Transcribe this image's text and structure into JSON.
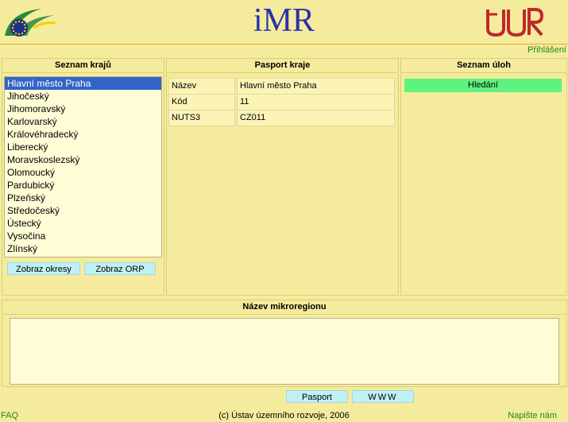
{
  "header": {
    "title": "iMR",
    "logo_left": "eu-flag-swoosh-logo",
    "logo_right": "uur-logo",
    "login_link": "Přihlášení"
  },
  "regions_panel": {
    "heading": "Seznam krajů",
    "items": [
      {
        "label": "Hlavní město Praha",
        "selected": true
      },
      {
        "label": "Jihočeský"
      },
      {
        "label": "Jihomoravský"
      },
      {
        "label": "Karlovarský"
      },
      {
        "label": "Královéhradecký"
      },
      {
        "label": "Liberecký"
      },
      {
        "label": "Moravskoslezský"
      },
      {
        "label": "Olomoucký"
      },
      {
        "label": "Pardubický"
      },
      {
        "label": "Plzeňský"
      },
      {
        "label": "Středočeský"
      },
      {
        "label": "Ústecký"
      },
      {
        "label": "Vysočina"
      },
      {
        "label": "Zlínský"
      }
    ],
    "show_districts_label": "Zobraz okresy",
    "show_orp_label": "Zobraz ORP"
  },
  "passport_panel": {
    "heading": "Pasport kraje",
    "rows": [
      {
        "key": "Název",
        "value": "Hlavní město Praha"
      },
      {
        "key": "Kód",
        "value": "11"
      },
      {
        "key": "NUTS3",
        "value": "CZ011"
      }
    ]
  },
  "tasks_panel": {
    "heading": "Seznam úloh",
    "search_label": "Hledání"
  },
  "microregion_panel": {
    "heading": "Název mikroregionu",
    "text_value": ""
  },
  "bottom_buttons": {
    "passport_label": "Pasport",
    "www_label": "WWW"
  },
  "footer": {
    "faq": "FAQ",
    "copyright": "(c) Ústav územního rozvoje, 2006",
    "contact": "Napište nám"
  },
  "colors": {
    "background": "#f4ec9c",
    "orange_bar": "#f0a22e",
    "title_blue": "#2b31a8",
    "link_green": "#1a8a1a",
    "selection": "#3264c8",
    "button_cyan": "#bff0f6",
    "search_green": "#5ff27f"
  }
}
